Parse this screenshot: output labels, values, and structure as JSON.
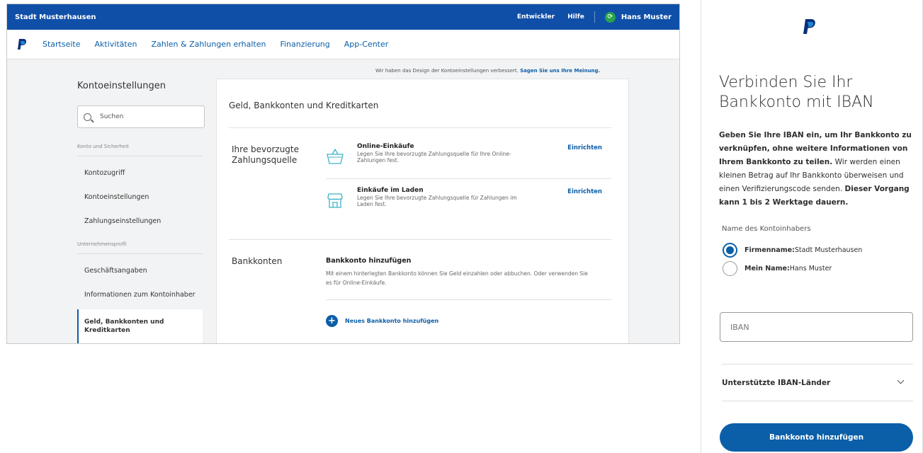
{
  "topbar": {
    "org_name": "Stadt Musterhausen",
    "developer_link": "Entwickler",
    "help_link": "Hilfe",
    "user_name": "Hans Muster"
  },
  "nav": {
    "items": [
      "Startseite",
      "Aktivitäten",
      "Zahlen & Zahlungen erhalten",
      "Finanzierung",
      "App-Center"
    ]
  },
  "notice": {
    "text": "Wir haben das Design der Kontoeinstellungen verbessert. ",
    "link": "Sagen Sie uns Ihre Meinung."
  },
  "sidebar": {
    "title": "Kontoeinstellungen",
    "search_placeholder": "Suchen",
    "section1": "Konto und Sicherheit",
    "section1_items": [
      "Kontozugriff",
      "Kontoeinstellungen",
      "Zahlungseinstellungen"
    ],
    "section2": "Unternehmensprofil",
    "section2_items": [
      "Geschäftsangaben",
      "Informationen zum Kontoinhaber"
    ],
    "active_item": "Geld, Bankkonten und Kreditkarten"
  },
  "card": {
    "title": "Geld, Bankkonten und Kreditkarten",
    "pref_label": "Ihre bevorzugte Zahlungsquelle",
    "online_title": "Online-Einkäufe",
    "online_desc": "Legen Sie Ihre bevorzugte Zahlungsquelle für Ihre Online-Zahlungen fest.",
    "online_link": "Einrichten",
    "store_title": "Einkäufe im Laden",
    "store_desc": "Legen Sie Ihre bevorzugte Zahlungsquelle für Zahlungen im Laden fest.",
    "store_link": "Einrichten",
    "bank_label": "Bankkonten",
    "bank_title": "Bankkonto hinzufügen",
    "bank_desc": "Mit einem hinterlegten Bankkonto können Sie Geld einzahlen oder abbuchen. Oder verwenden Sie es für Online-Einkäufe.",
    "add_bank_link": "Neues Bankkonto hinzufügen"
  },
  "modal": {
    "heading": "Verbinden Sie Ihr Bankkonto mit IBAN",
    "intro_bold1": "Geben Sie Ihre IBAN ein, um Ihr Bankkonto zu verknüpfen, ohne weitere Informationen von Ihrem Bankkonto zu teilen.",
    "intro_text": " Wir werden einen kleinen Betrag auf Ihr Bankkonto überweisen und einen Verifizierungscode senden. ",
    "intro_bold2": "Dieser Vorgang kann 1 bis 2 Werktage dauern.",
    "holder_label": "Name des Kontoinhabers",
    "option1_label": "Firmenname:",
    "option1_value": " Stadt Musterhausen",
    "option2_label": "Mein Name:",
    "option2_value": " Hans Muster",
    "iban_placeholder": "IBAN",
    "countries_label": "Unterstützte IBAN-Länder",
    "submit_label": "Bankkonto hinzufügen"
  },
  "colors": {
    "brand_blue": "#0f4fa8",
    "link_blue": "#0b5ea8",
    "icon_teal": "#3ab3c6"
  }
}
